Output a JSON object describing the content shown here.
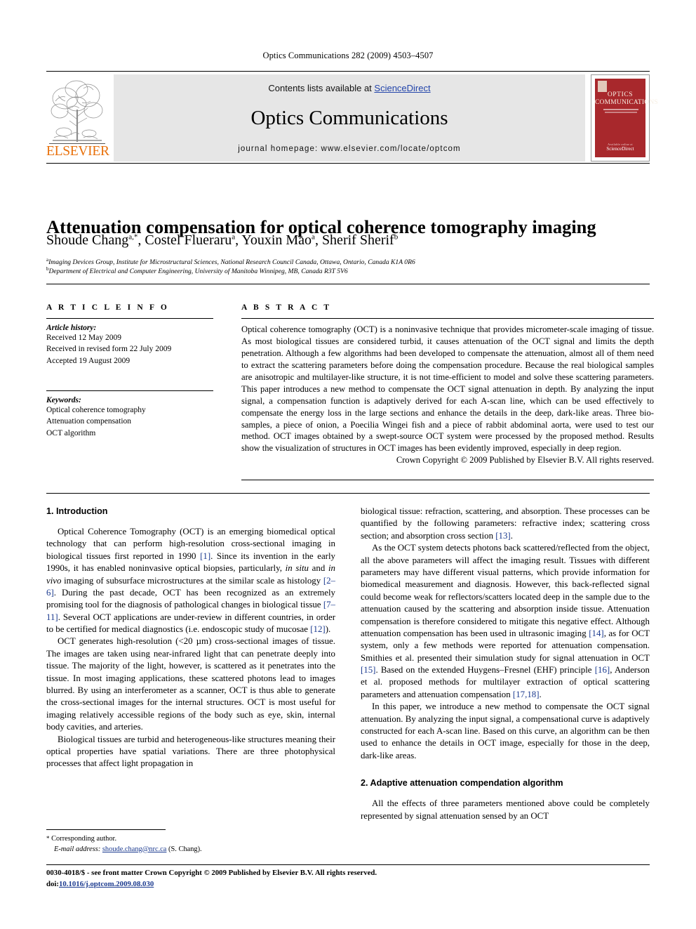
{
  "running_head": "Optics Communications 282 (2009) 4503–4507",
  "masthead": {
    "contents_prefix": "Contents lists available at ",
    "contents_link": "ScienceDirect",
    "journal_title": "Optics Communications",
    "homepage": "journal homepage: www.elsevier.com/locate/optcom",
    "publisher_logo_text": "ELSEVIER",
    "cover": {
      "line1": "OPTICS",
      "line2": "COMMUNICATIONS",
      "foot_small": "Available online at",
      "foot_brand": "ScienceDirect"
    }
  },
  "article": {
    "title": "Attenuation compensation for optical coherence tomography imaging",
    "authors_html": "Shoude Chang<sup>a,*</sup>, Costel Flueraru<sup>a</sup>, Youxin Mao<sup>a</sup>, Sherif Sherif<sup>b</sup>",
    "affiliation_a": "Imaging Devices Group, Institute for Microstructural Sciences, National Research Council Canada, Ottawa, Ontario, Canada K1A 0R6",
    "affiliation_b": "Department of Electrical and Computer Engineering, University of Manitoba Winnipeg, MB, Canada R3T 5V6"
  },
  "info": {
    "heading": "A R T I C L E    I N F O",
    "history_label": "Article history:",
    "history": [
      "Received 12 May 2009",
      "Received in revised form 22 July 2009",
      "Accepted 19 August 2009"
    ],
    "keywords_label": "Keywords:",
    "keywords": [
      "Optical coherence tomography",
      "Attenuation compensation",
      "OCT algorithm"
    ]
  },
  "abstract": {
    "heading": "A B S T R A C T",
    "text": "Optical coherence tomography (OCT) is a noninvasive technique that provides micrometer-scale imaging of tissue. As most biological tissues are considered turbid, it causes attenuation of the OCT signal and limits the depth penetration. Although a few algorithms had been developed to compensate the attenuation, almost all of them need to extract the scattering parameters before doing the compensation procedure. Because the real biological samples are anisotropic and multilayer-like structure, it is not time-efficient to model and solve these scattering parameters. This paper introduces a new method to compensate the OCT signal attenuation in depth. By analyzing the input signal, a compensation function is adaptively derived for each A-scan line, which can be used effectively to compensate the energy loss in the large sections and enhance the details in the deep, dark-like areas. Three bio-samples, a piece of onion, a Poecilia Wingei fish and a piece of rabbit abdominal aorta, were used to test our method. OCT images obtained by a swept-source OCT system were processed by the proposed method. Results show the visualization of structures in OCT images has been evidently improved, especially in deep region.",
    "copyright": "Crown Copyright © 2009 Published by Elsevier B.V. All rights reserved."
  },
  "body": {
    "section1_heading": "1. Introduction",
    "section2_heading": "2. Adaptive attenuation compendation algorithm",
    "left_paragraphs": [
      "Optical Coherence Tomography (OCT) is an emerging biomedical optical technology that can perform high-resolution cross-sectional imaging in biological tissues first reported in 1990 <span class=\"ref\">[1]</span>. Since its invention in the early 1990s, it has enabled noninvasive optical biopsies, particularly, <span class=\"ital\">in situ</span> and <span class=\"ital\">in vivo</span> imaging of subsurface microstructures at the similar scale as histology <span class=\"ref\">[2–6]</span>. During the past decade, OCT has been recognized as an extremely promising tool for the diagnosis of pathological changes in biological tissue <span class=\"ref\">[7–11]</span>. Several OCT applications are under-review in different countries, in order to be certified for medical diagnostics (i.e. endoscopic study of mucosae <span class=\"ref\">[12]</span>).",
      "OCT generates high-resolution (&lt;20 µm) cross-sectional images of tissue. The images are taken using near-infrared light that can penetrate deeply into tissue. The majority of the light, however, is scattered as it penetrates into the tissue. In most imaging applications, these scattered photons lead to images blurred. By using an interferometer as a scanner, OCT is thus able to generate the cross-sectional images for the internal structures. OCT is most useful for imaging relatively accessible regions of the body such as eye, skin, internal body cavities, and arteries.",
      "Biological tissues are turbid and heterogeneous-like structures meaning their optical properties have spatial variations. There are three photophysical processes that affect light propagation in"
    ],
    "right_paragraphs": [
      "biological tissue: refraction, scattering, and absorption. These processes can be quantified by the following parameters: refractive index; scattering cross section; and absorption cross section <span class=\"ref\">[13]</span>.",
      "As the OCT system detects photons back scattered/reflected from the object, all the above parameters will affect the imaging result. Tissues with different parameters may have different visual patterns, which provide information for biomedical measurement and diagnosis. However, this back-reflected signal could become weak for reflectors/scatters located deep in the sample due to the attenuation caused by the scattering and absorption inside tissue. Attenuation compensation is therefore considered to mitigate this negative effect. Although attenuation compensation has been used in ultrasonic imaging <span class=\"ref\">[14]</span>, as for OCT system, only a few methods were reported for attenuation compensation. Smithies et al. presented their simulation study for signal attenuation in OCT <span class=\"ref\">[15]</span>. Based on the extended Huygens–Fresnel (EHF) principle <span class=\"ref\">[16]</span>, Anderson et al. proposed methods for multilayer extraction of optical scattering parameters and attenuation compensation <span class=\"ref\">[17,18]</span>.",
      "In this paper, we introduce a new method to compensate the OCT signal attenuation. By analyzing the input signal, a compensational curve is adaptively constructed for each A-scan line. Based on this curve, an algorithm can be then used to enhance the details in OCT image, especially for those in the deep, dark-like areas."
    ],
    "section2_paragraph": "All the effects of three parameters mentioned above could be completely represented by signal attenuation sensed by an OCT"
  },
  "footnote": {
    "corresponding": "Corresponding author.",
    "email_label": "E-mail address:",
    "email": "shoude.chang@nrc.ca",
    "email_suffix": "(S. Chang)."
  },
  "imprint": {
    "line1": "0030-4018/$ - see front matter Crown Copyright © 2009 Published by Elsevier B.V. All rights reserved.",
    "doi_prefix": "doi:",
    "doi": "10.1016/j.optcom.2009.08.030"
  },
  "colors": {
    "link": "#1b3a8f",
    "sciencedirect": "#2244aa",
    "elsevier_orange": "#E8700A",
    "cover_red": "#a8282c",
    "masthead_gray": "#e6e6e6"
  }
}
